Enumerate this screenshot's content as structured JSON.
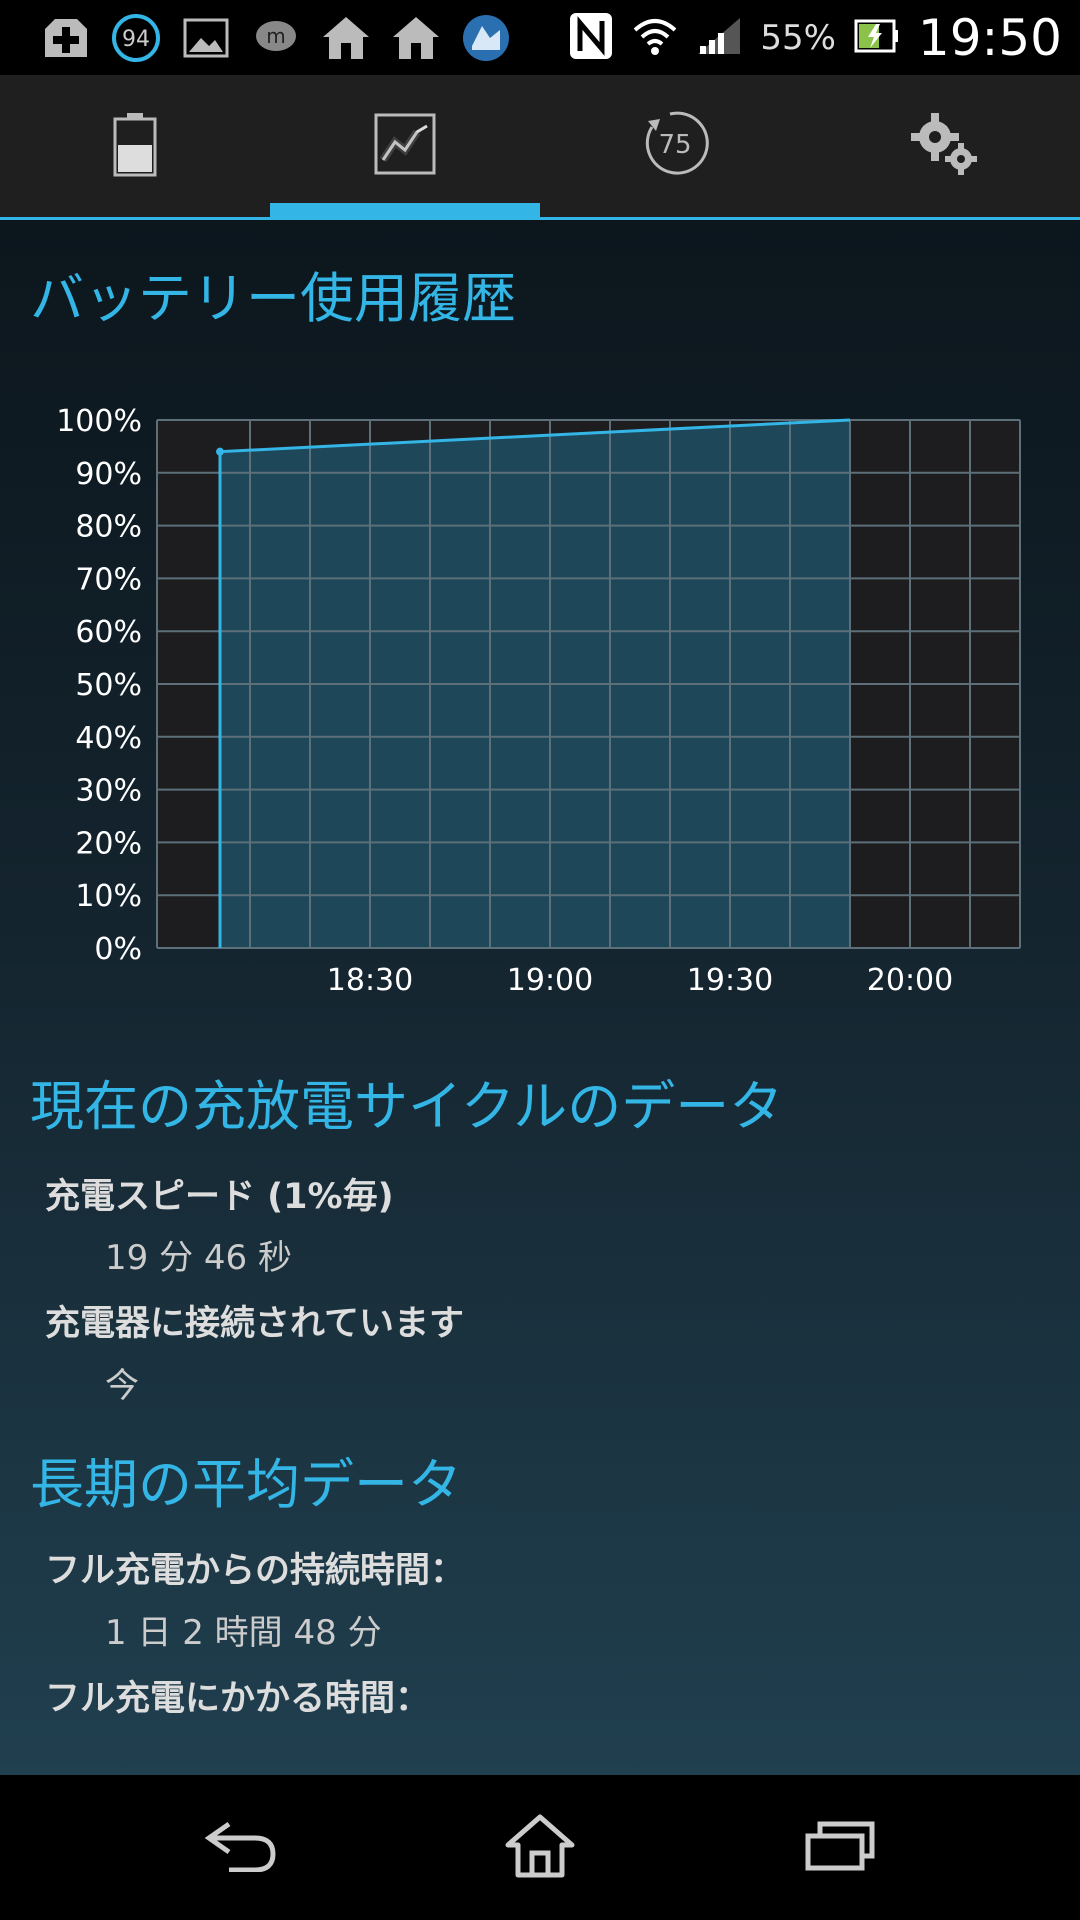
{
  "status_bar": {
    "notification_icons": [
      "medical-plus-icon",
      "ring-94-icon",
      "image-icon",
      "chat-bubble-icon",
      "home-icon",
      "home-icon",
      "app-icon"
    ],
    "ring_number": "94",
    "battery_percent": "55%",
    "time": "19:50"
  },
  "tabs": [
    {
      "name": "battery",
      "icon": "battery-icon",
      "selected": false
    },
    {
      "name": "history",
      "icon": "line-chart-icon",
      "selected": true
    },
    {
      "name": "speed",
      "icon": "gauge-icon",
      "selected": false,
      "badge": "75"
    },
    {
      "name": "settings",
      "icon": "gears-icon",
      "selected": false
    }
  ],
  "history": {
    "title": "バッテリー使用履歴"
  },
  "chart_data": {
    "type": "area",
    "title": "",
    "xlabel": "",
    "ylabel": "",
    "y_tick_labels": [
      "100%",
      "90%",
      "80%",
      "70%",
      "60%",
      "50%",
      "40%",
      "30%",
      "20%",
      "10%",
      "0%"
    ],
    "x_tick_labels": [
      "18:30",
      "19:00",
      "19:30",
      "20:00"
    ],
    "ylim": [
      0,
      100
    ],
    "series": [
      {
        "x": [
          "18:05",
          "18:05",
          "19:50"
        ],
        "y": [
          0,
          94,
          100
        ]
      }
    ],
    "grid": true,
    "color": "#33b5e5"
  },
  "cycle": {
    "title": "現在の充放電サイクルのデータ",
    "charge_speed_label": "充電スピード (1%毎)",
    "charge_speed_value": "19 分 46 秒",
    "connected_label": "充電器に接続されています",
    "connected_value": "今"
  },
  "average": {
    "title": "長期の平均データ",
    "duration_label": "フル充電からの持続時間：",
    "duration_value": "1 日 2 時間 48 分",
    "full_charge_label": "フル充電にかかる時間："
  },
  "nav": {
    "back_icon": "back-icon",
    "home_icon": "home-icon",
    "recents_icon": "recents-icon"
  }
}
